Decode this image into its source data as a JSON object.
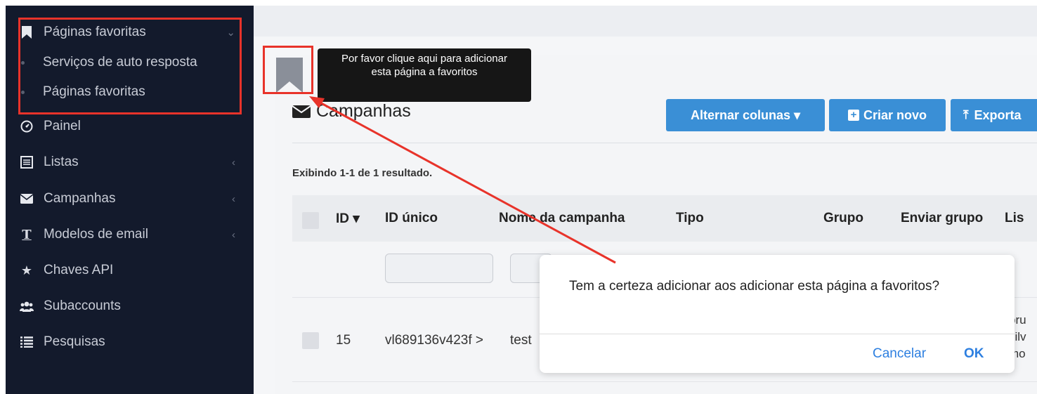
{
  "sidebar": {
    "favorites": {
      "label": "Páginas favoritas",
      "icon": "bookmark-icon"
    },
    "sub_items": [
      {
        "label": "Serviços de auto resposta"
      },
      {
        "label": "Páginas favoritas"
      }
    ],
    "items": [
      {
        "label": "Painel",
        "icon": "dashboard-icon"
      },
      {
        "label": "Listas",
        "icon": "list-icon"
      },
      {
        "label": "Campanhas",
        "icon": "envelope-icon"
      },
      {
        "label": "Modelos de email",
        "icon": "text-icon"
      },
      {
        "label": "Chaves API",
        "icon": "star-icon"
      },
      {
        "label": "Subaccounts",
        "icon": "users-icon"
      },
      {
        "label": "Pesquisas",
        "icon": "list-lines-icon"
      }
    ]
  },
  "tooltip": {
    "text": "Por favor clique aqui para adicionar esta página a favoritos"
  },
  "page": {
    "title": "Campanhas",
    "summary": "Exibindo 1-1 de 1 resultado."
  },
  "toolbar": {
    "toggle_columns": "Alternar colunas ▾",
    "create_new": "Criar novo",
    "export": "Exporta"
  },
  "table": {
    "headers": {
      "id": "ID ▾",
      "unique_id": "ID único",
      "campaign_name": "Nome da campanha",
      "type": "Tipo",
      "group": "Grupo",
      "send_group": "Enviar grupo",
      "list": "Lis"
    },
    "row": {
      "id": "15",
      "unique_id": "vl689136v423f >",
      "name": "test",
      "list_lines": [
        "bru",
        "silv",
        "mo"
      ]
    }
  },
  "modal": {
    "message": "Tem a certeza  adicionar aos adicionar esta página a favoritos?",
    "cancel": "Cancelar",
    "ok": "OK"
  },
  "colors": {
    "sidebar_bg": "#131a2c",
    "accent": "#3a8fd6",
    "highlight": "#e8332a",
    "modal_link": "#2d7fe0"
  }
}
